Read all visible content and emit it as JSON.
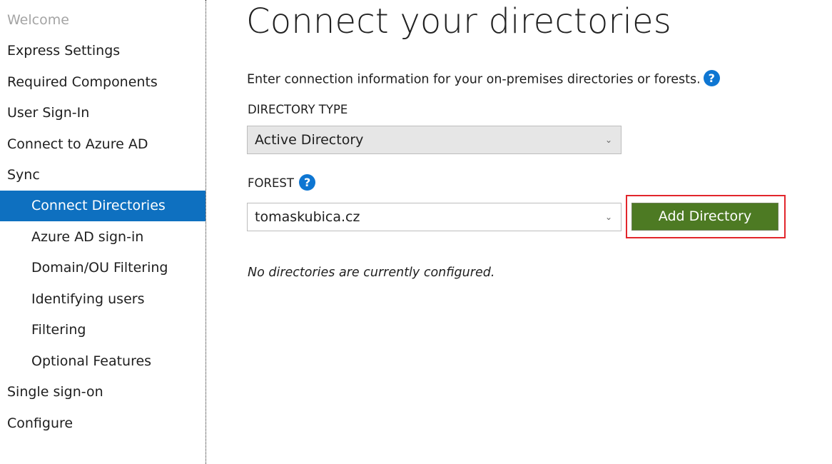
{
  "sidebar": {
    "items": [
      {
        "label": "Welcome"
      },
      {
        "label": "Express Settings"
      },
      {
        "label": "Required Components"
      },
      {
        "label": "User Sign-In"
      },
      {
        "label": "Connect to Azure AD"
      },
      {
        "label": "Sync"
      },
      {
        "label": "Connect Directories"
      },
      {
        "label": "Azure AD sign-in"
      },
      {
        "label": "Domain/OU Filtering"
      },
      {
        "label": "Identifying users"
      },
      {
        "label": "Filtering"
      },
      {
        "label": "Optional Features"
      },
      {
        "label": "Single sign-on"
      },
      {
        "label": "Configure"
      }
    ]
  },
  "main": {
    "title": "Connect your directories",
    "intro": "Enter connection information for your on-premises directories or forests.",
    "help_glyph": "?",
    "directory_type": {
      "label": "DIRECTORY TYPE",
      "value": "Active Directory"
    },
    "forest": {
      "label": "FOREST",
      "value": "tomaskubica.cz"
    },
    "add_button": "Add Directory",
    "empty_message": "No directories are currently configured."
  },
  "colors": {
    "active_nav": "#0e70c0",
    "button": "#4d7a23",
    "highlight_border": "#e2262c",
    "help_icon": "#0e76d2"
  }
}
